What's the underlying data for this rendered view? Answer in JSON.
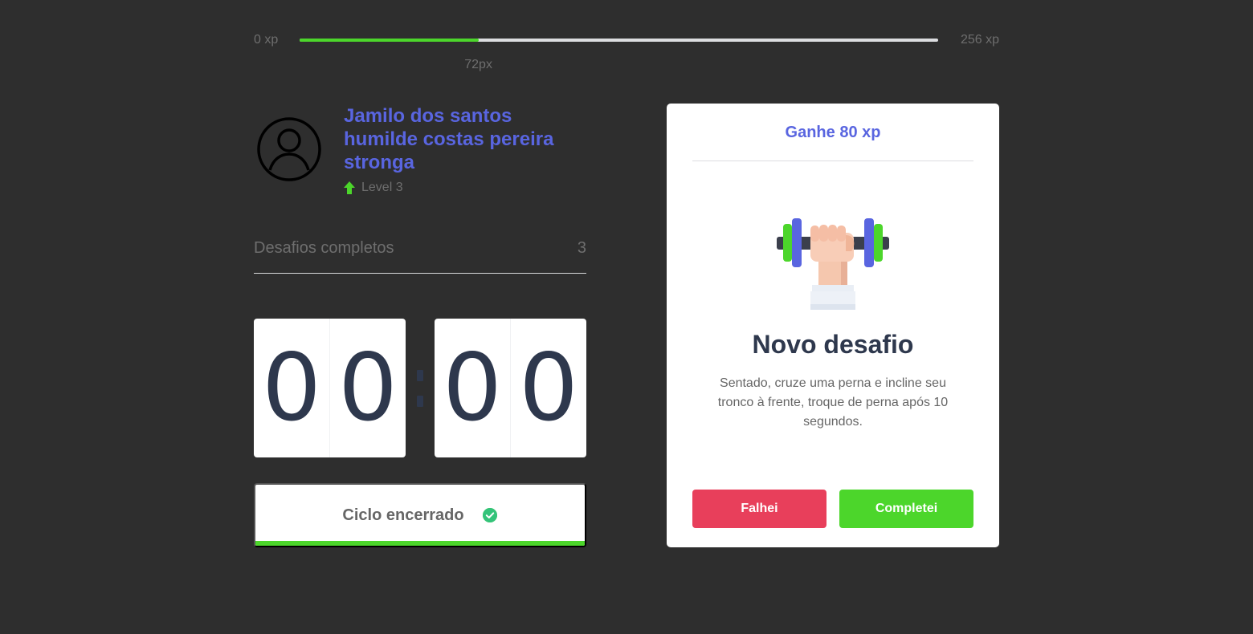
{
  "xp": {
    "min_label": "0 xp",
    "max_label": "256 xp",
    "current_label": "72px",
    "progress_fraction": 0.28
  },
  "profile": {
    "name": "Jamilo dos santos humilde costas pereira stronga",
    "level_label": "Level 3",
    "avatar_icon": "user-circle-icon",
    "level_icon": "level-up-arrow-icon"
  },
  "challenges": {
    "label": "Desafios completos",
    "count": "3"
  },
  "countdown": {
    "minutes": [
      "0",
      "0"
    ],
    "seconds": [
      "0",
      "0"
    ]
  },
  "cycle_button": {
    "label": "Ciclo encerrado",
    "icon": "check-circle-icon"
  },
  "challenge_card": {
    "header": "Ganhe 80 xp",
    "illustration": "dumbbell-icon",
    "title": "Novo desafio",
    "description": "Sentado, cruze uma perna e incline seu tronco à frente, troque de perna após 10 segundos.",
    "fail_label": "Falhei",
    "success_label": "Completei"
  },
  "colors": {
    "background": "#2e2e2e",
    "accent_blue": "#5965e0",
    "success_green": "#4cd62b",
    "fail_red": "#e83f5b",
    "title_dark": "#2e384d"
  }
}
